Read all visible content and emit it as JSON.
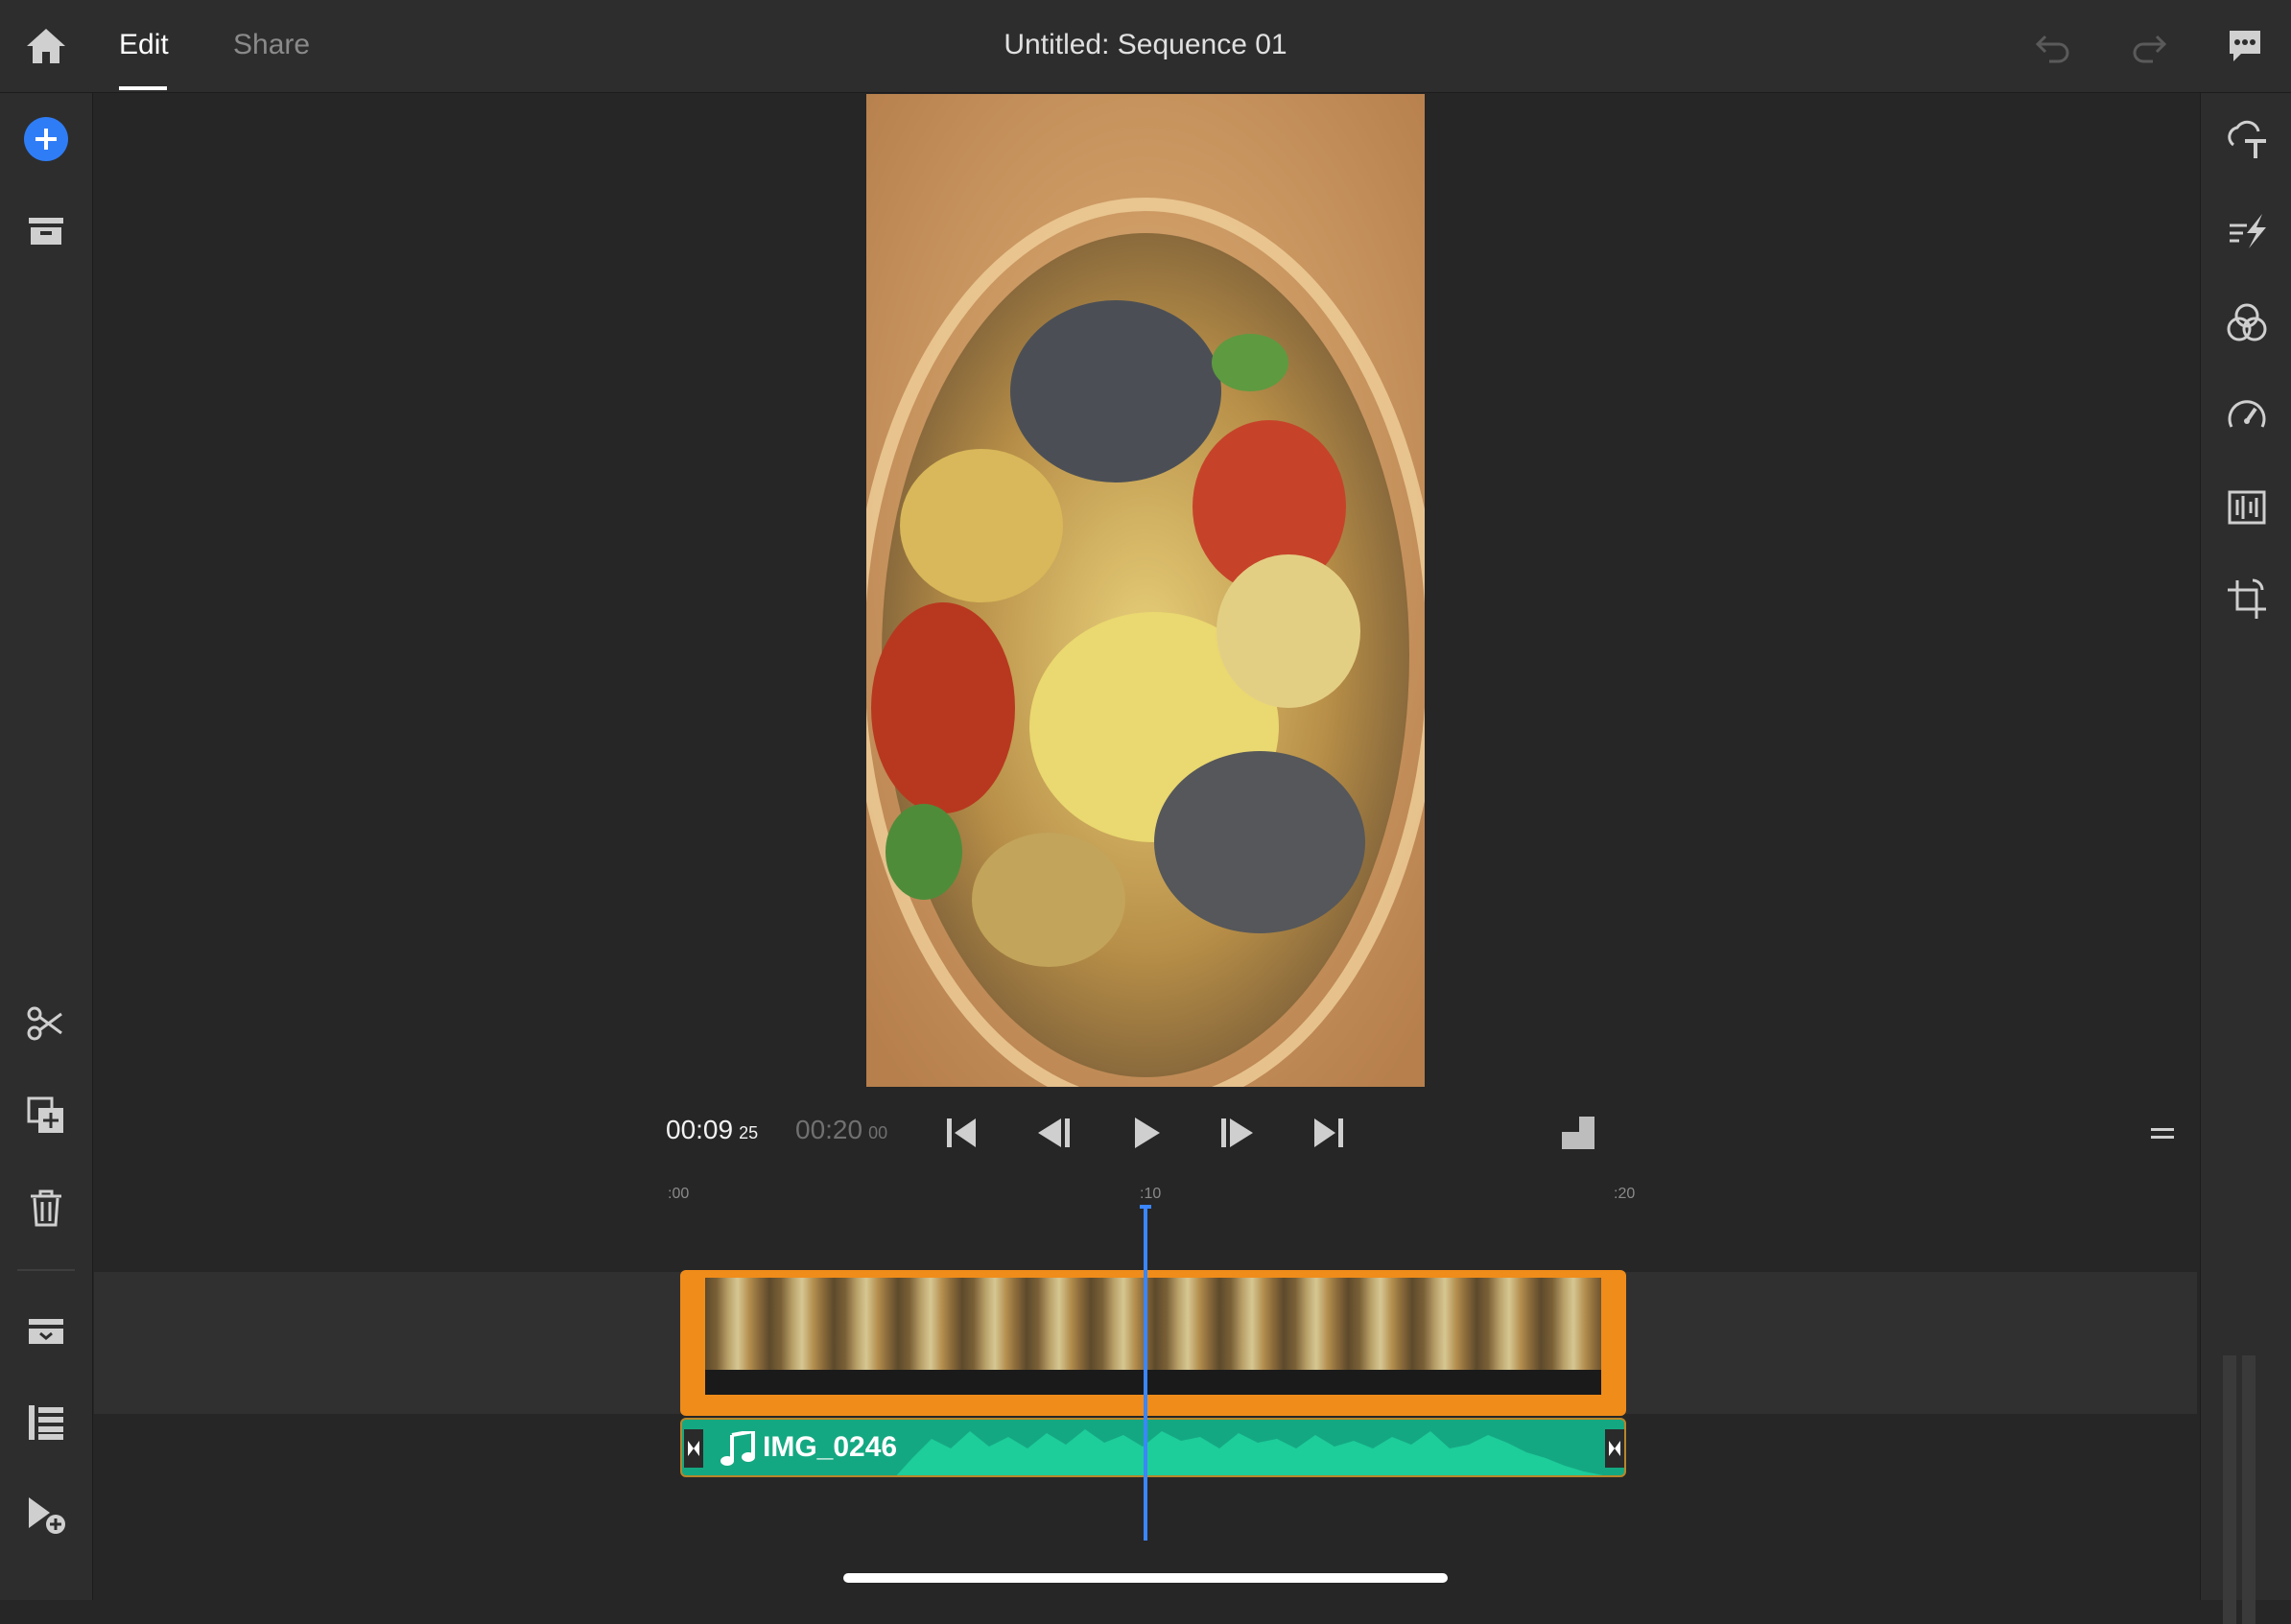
{
  "header": {
    "tabs": [
      {
        "label": "Edit",
        "active": true
      },
      {
        "label": "Share",
        "active": false
      }
    ],
    "title": "Untitled: Sequence 01"
  },
  "left_toolbar": {
    "icons": [
      "add-media-icon",
      "project-icon",
      "split-clip-icon",
      "duplicate-icon",
      "delete-icon",
      "titles-icon",
      "track-list-icon",
      "add-clip-icon"
    ]
  },
  "right_toolbar": {
    "icons": [
      "share-upload-icon",
      "transitions-icon",
      "color-icon",
      "speed-icon",
      "audio-icon",
      "crop-icon"
    ]
  },
  "player": {
    "current_time": "00:09",
    "current_frames": "25",
    "duration_time": "00:20",
    "duration_frames": "00"
  },
  "ruler": {
    "labels": [
      ":00",
      ":10",
      ":20"
    ]
  },
  "timeline": {
    "audio_clip_label": "IMG_0246",
    "playhead_fraction": 0.48
  },
  "colors": {
    "accent": "#3b86ff",
    "clip_border": "#f08c1a",
    "audio": "#14a882"
  }
}
